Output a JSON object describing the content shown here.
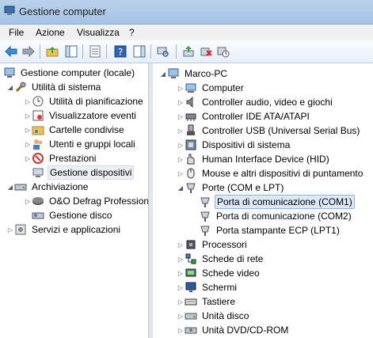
{
  "window": {
    "title": "Gestione computer"
  },
  "menu": [
    "File",
    "Azione",
    "Visualizza",
    "?"
  ],
  "colors": {
    "selection": "#dce8f6",
    "titlebar": "#b9d1ea",
    "toolbar": "#e6eef8"
  },
  "left_tree": {
    "root": "Gestione computer (locale)",
    "utilita": "Utilità di sistema",
    "utilita_items": [
      "Utilità di pianificazione",
      "Visualizzatore eventi",
      "Cartelle condivise",
      "Utenti e gruppi locali",
      "Prestazioni",
      "Gestione dispositivi"
    ],
    "archiviazione": "Archiviazione",
    "archiviazione_items": [
      "O&O Defrag Profession",
      "Gestione disco"
    ],
    "servizi": "Servizi e applicazioni"
  },
  "right_tree": {
    "root": "Marco-PC",
    "categories": [
      "Computer",
      "Controller audio, video e giochi",
      "Controller IDE ATA/ATAPI",
      "Controller USB (Universal Serial Bus)",
      "Dispositivi di sistema",
      "Human Interface Device (HID)",
      "Mouse e altri dispositivi di puntamento",
      "Porte (COM e LPT)"
    ],
    "ports": [
      "Porta di comunicazione (COM1)",
      "Porta di comunicazione (COM2)",
      "Porta stampante ECP (LPT1)"
    ],
    "categories2": [
      "Processori",
      "Schede di rete",
      "Schede video",
      "Schermi",
      "Tastiere",
      "Unità disco",
      "Unità DVD/CD-ROM"
    ]
  }
}
